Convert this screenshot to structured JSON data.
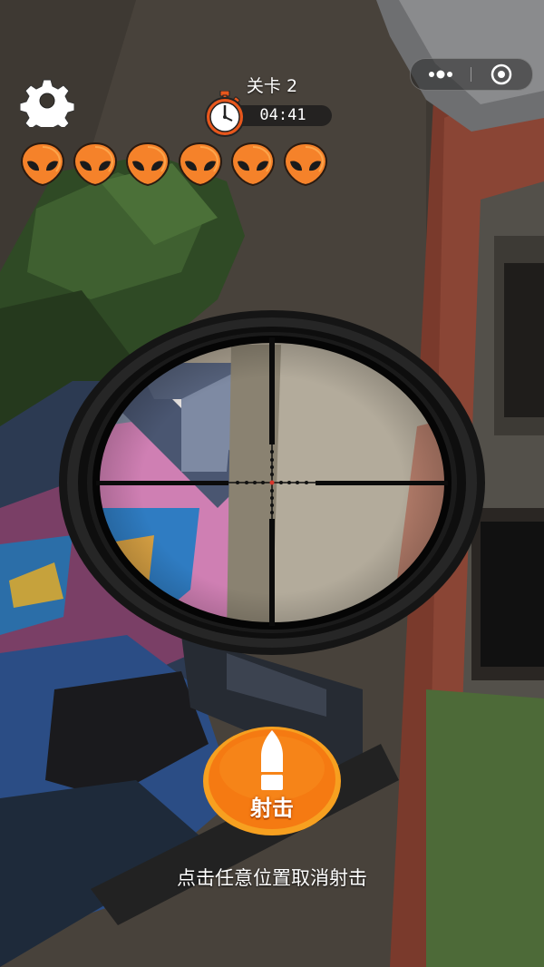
{
  "hud": {
    "level_label": "关卡 2",
    "timer": "04:41",
    "settings_icon": "gear-icon",
    "stopwatch_icon": "stopwatch-icon"
  },
  "targets": {
    "icon": "alien-head-icon",
    "remaining": 6,
    "color": "#f5822a"
  },
  "mini_program_menu": {
    "more_icon": "more-dots-icon",
    "close_icon": "target-close-icon"
  },
  "fire_button": {
    "label": "射击",
    "icon": "bullet-icon",
    "color": "#f57a12"
  },
  "hint_text": "点击任意位置取消射击",
  "scope": {
    "reticle": "crosshair",
    "dot_color": "#d8362c"
  }
}
